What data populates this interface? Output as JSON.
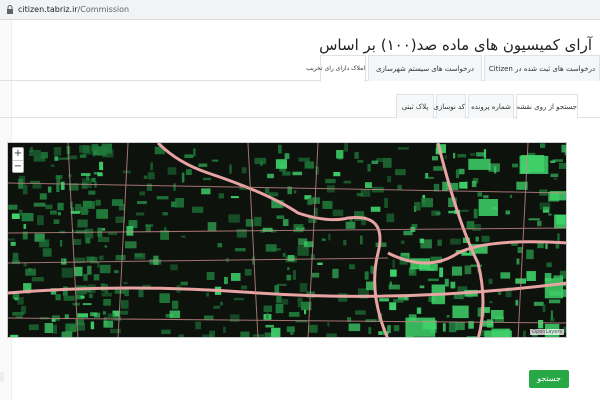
{
  "browser": {
    "url_host": "citizen.tabriz.ir",
    "url_path": "/Commission"
  },
  "page": {
    "title": "آرای کمیسیون های ماده صد(۱۰۰) بر اساس"
  },
  "main_tabs": [
    {
      "label": "درخواست های ثبت شده در Citizen",
      "active": false
    },
    {
      "label": "درخواست های سیستم شهرسازی",
      "active": false
    },
    {
      "label": "املاک دارای رای تخریب",
      "active": true
    }
  ],
  "sub_tabs": [
    {
      "label": "جستجو از روی نقشه",
      "active": true
    },
    {
      "label": "شماره پرونده",
      "active": false
    },
    {
      "label": "کد نوسازی",
      "active": false
    },
    {
      "label": "پلاک ثبتی",
      "active": false
    }
  ],
  "map": {
    "zoom_in": "+",
    "zoom_out": "−",
    "attribution": "OpenLayers"
  },
  "actions": {
    "search_label": "جستجو"
  },
  "colors": {
    "map_bg": "#0d120d",
    "parcel_green": "#3fd36b",
    "parcel_dark_green": "#1f7a3a",
    "road": "#e8a3a3",
    "button_green": "#28a745"
  }
}
